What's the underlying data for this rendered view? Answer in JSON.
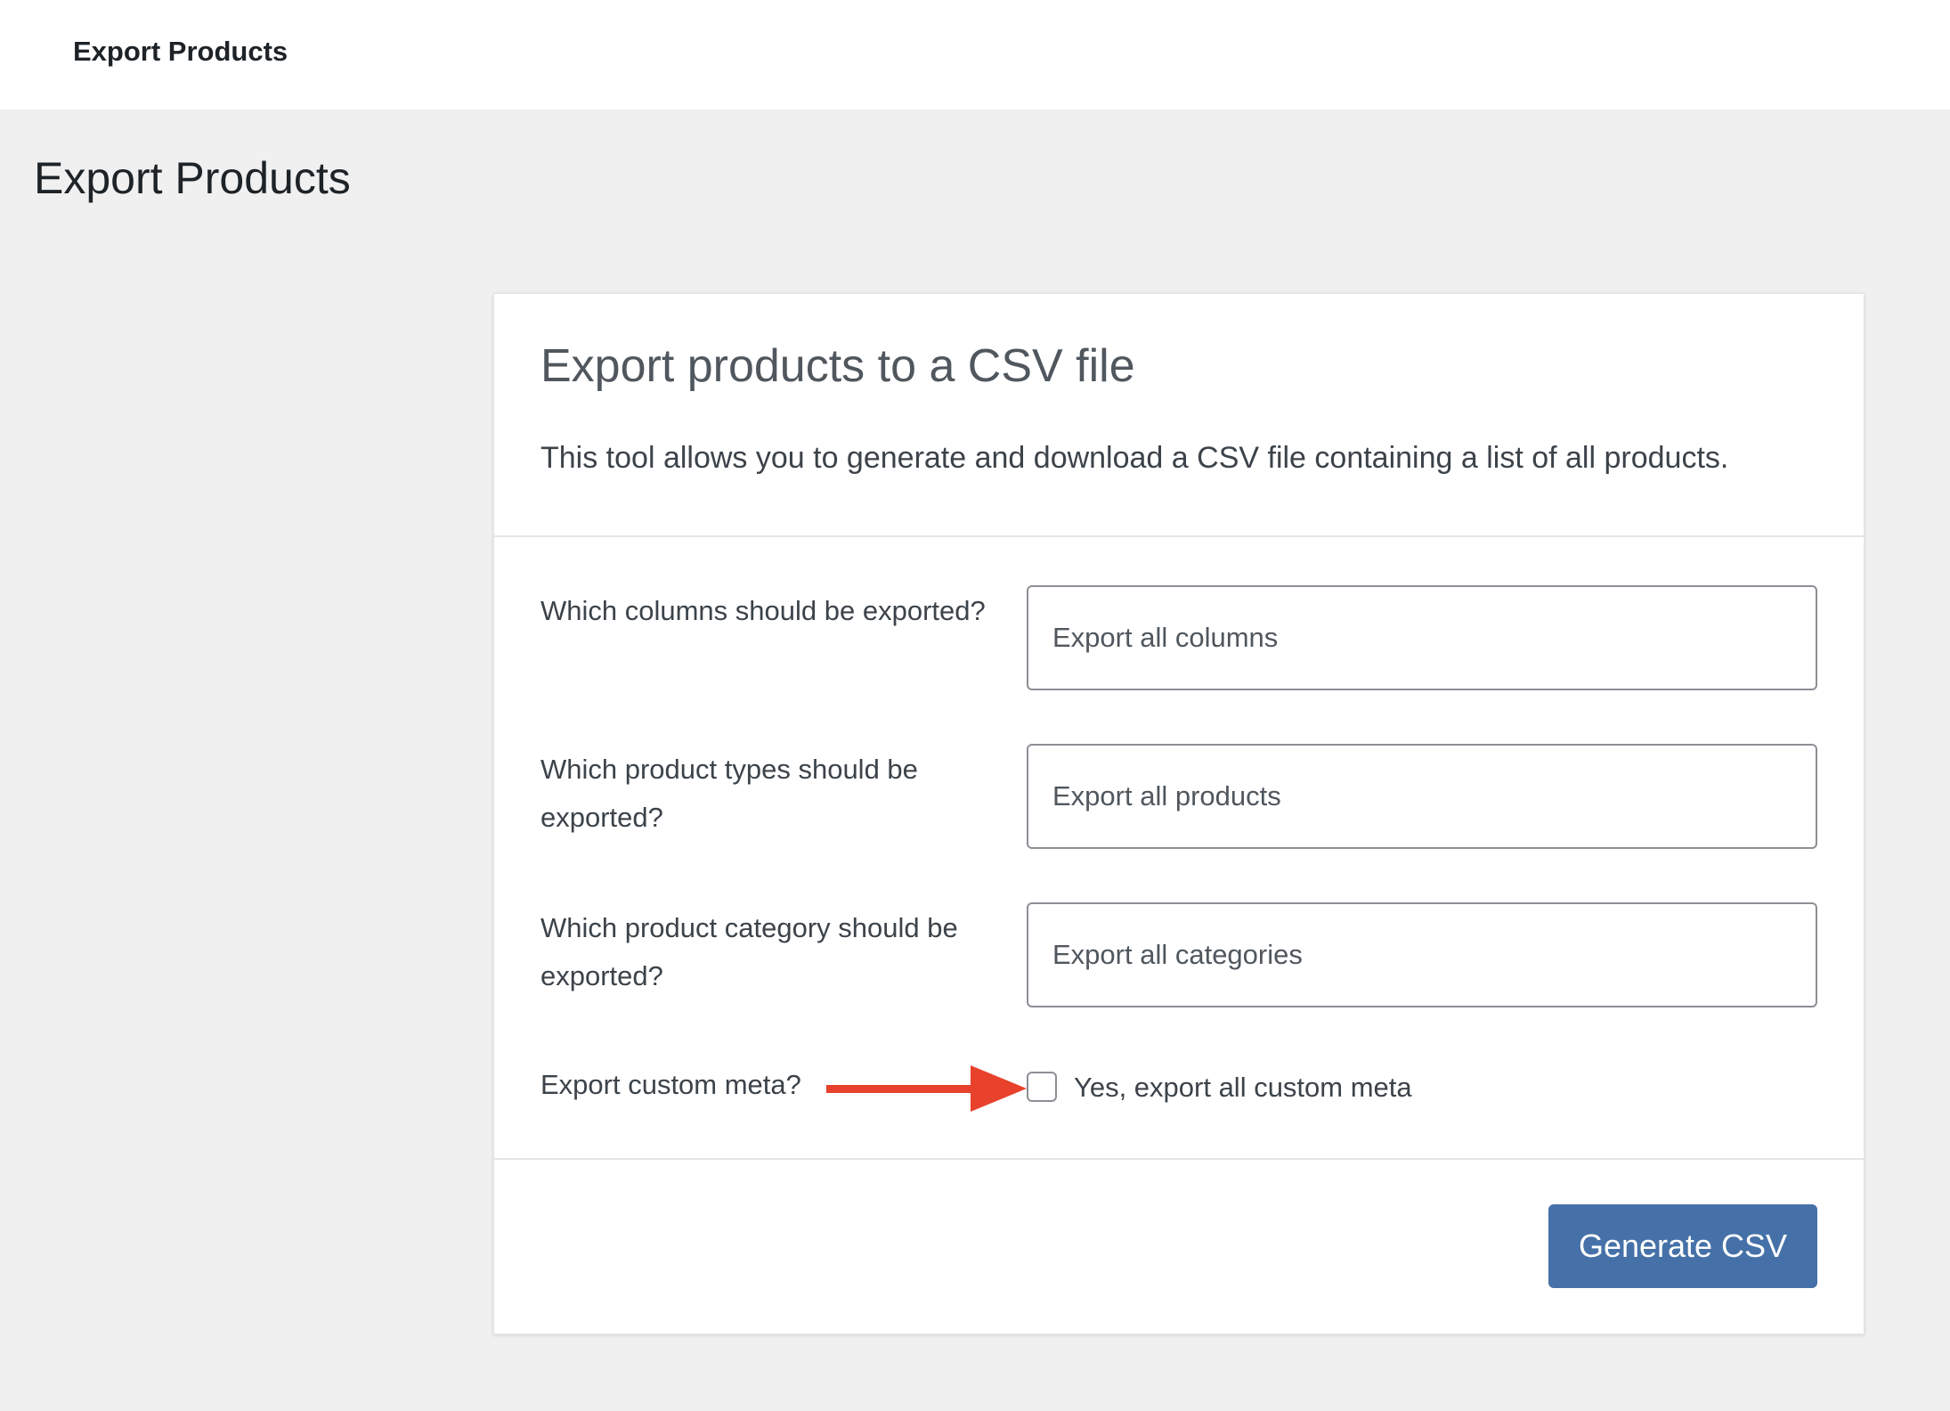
{
  "topbar": {
    "title": "Export Products"
  },
  "page": {
    "title": "Export Products"
  },
  "card": {
    "title": "Export products to a CSV file",
    "description": "This tool allows you to generate and download a CSV file containing a list of all products.",
    "rows": [
      {
        "label": "Which columns should be exported?",
        "placeholder": "Export all columns"
      },
      {
        "label": "Which product types should be exported?",
        "placeholder": "Export all products"
      },
      {
        "label": "Which product category should be exported?",
        "placeholder": "Export all categories"
      }
    ],
    "custom_meta": {
      "label": "Export custom meta?",
      "checkbox_label": "Yes, export all custom meta",
      "checked": false
    },
    "generate_button": "Generate CSV"
  },
  "annotation": {
    "arrow_color": "#e8412c",
    "arrow_icon": "arrow-right-icon"
  },
  "colors": {
    "page_bg": "#f0f0f1",
    "button_bg": "#4671a8"
  }
}
